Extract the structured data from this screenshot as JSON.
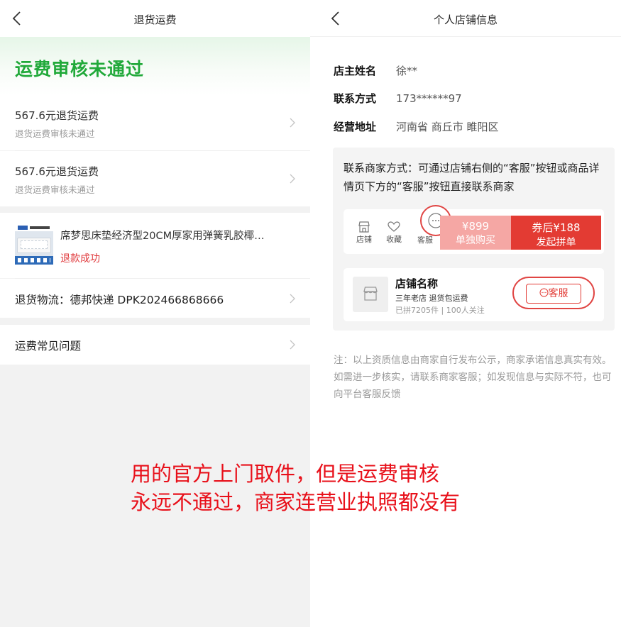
{
  "left": {
    "nav_title": "退货运费",
    "header_title": "运费审核未通过",
    "fees": [
      {
        "amount": "567.6元退货运费",
        "status": "退货运费审核未通过"
      },
      {
        "amount": "567.6元退货运费",
        "status": "退货运费审核未通过"
      }
    ],
    "product": {
      "name": "席梦思床垫经济型20CM厚家用弹簧乳胶椰…",
      "status": "退款成功"
    },
    "logistics": "退货物流：德邦快递 DPK202466868666",
    "faq": "运费常见问题"
  },
  "right": {
    "nav_title": "个人店铺信息",
    "info": [
      {
        "key": "店主姓名",
        "value": "徐**"
      },
      {
        "key": "联系方式",
        "value": "173******97"
      },
      {
        "key": "经营地址",
        "value": "河南省 商丘市 睢阳区"
      }
    ],
    "tip": "联系商家方式：可通过店铺右侧的“客服”按钮或商品详情页下方的“客服”按钮直接联系商家",
    "mock_bar": {
      "icons": [
        {
          "label": "店铺",
          "icon": "store-icon"
        },
        {
          "label": "收藏",
          "icon": "heart-icon"
        },
        {
          "label": "客服",
          "icon": "chat-icon"
        }
      ],
      "single_price": "¥899",
      "single_label": "单独购买",
      "group_price": "券后¥188",
      "group_label": "发起拼单"
    },
    "mock_shop": {
      "name": "店铺名称",
      "tag": "三年老店 退货包运费",
      "stat": "已拼7205件 | 100人关注",
      "service_btn": "客服"
    },
    "note": "注：以上资质信息由商家自行发布公示，商家承诺信息真实有效。如需进一步核实，请联系商家客服；如发现信息与实际不符，也可向平台客服反馈"
  },
  "overlay": {
    "line1": "用的官方上门取件，但是运费审核",
    "line2": "永远不通过，商家连营业执照都没有"
  },
  "colors": {
    "green": "#21a93a",
    "red": "#e33b33",
    "annotation": "#e8101a"
  }
}
